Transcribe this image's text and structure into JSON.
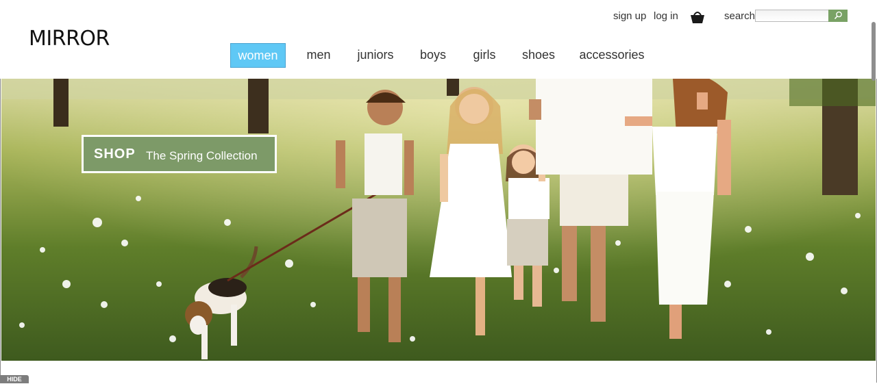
{
  "brand": {
    "logo_text": "MIRROR"
  },
  "header": {
    "sign_up": "sign up",
    "log_in": "log in",
    "basket_icon": "shopping-basket-icon",
    "search_label": "search",
    "search_value": "",
    "search_button_icon": "magnifier-icon"
  },
  "nav": {
    "items": [
      {
        "label": "women",
        "active": true
      },
      {
        "label": "men",
        "active": false
      },
      {
        "label": "juniors",
        "active": false
      },
      {
        "label": "boys",
        "active": false
      },
      {
        "label": "girls",
        "active": false
      },
      {
        "label": "shoes",
        "active": false
      },
      {
        "label": "accessories",
        "active": false
      }
    ]
  },
  "hero": {
    "image": "family-walking-with-dog-in-meadow",
    "banner_shop": "SHOP",
    "banner_text": "The Spring Collection"
  },
  "footer": {
    "hide_tab": "HIDE"
  },
  "colors": {
    "nav_active_bg": "#5fc8f5",
    "banner_bg": "#7d9a68",
    "search_button_bg": "#79a265"
  }
}
